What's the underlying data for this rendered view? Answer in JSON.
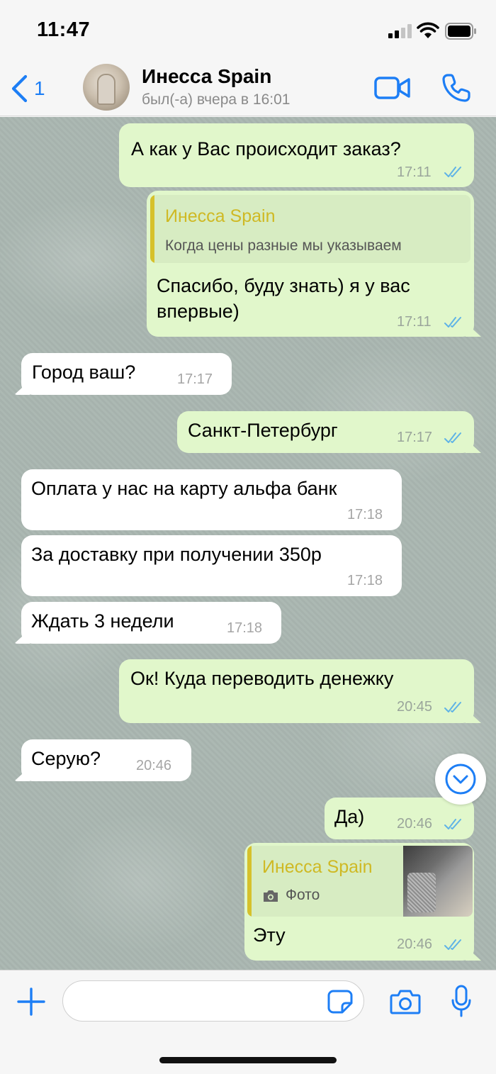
{
  "status_bar": {
    "time": "11:47"
  },
  "header": {
    "back_count": "1",
    "contact_name": "Инесса Spain",
    "contact_status": "был(-а) вчера в 16:01"
  },
  "messages": [
    {
      "direction": "outgoing",
      "text": "А как у Вас происходит заказ?",
      "time": "17:11",
      "read": true
    },
    {
      "direction": "outgoing",
      "quote_author": "Инесса Spain",
      "quote_text": "Когда цены разные мы указываем",
      "text_line1": "Спасибо, буду знать) я у вас",
      "text_line2": "впервые)",
      "time": "17:11",
      "read": true
    },
    {
      "direction": "incoming",
      "text": "Город ваш?",
      "time": "17:17"
    },
    {
      "direction": "outgoing",
      "text": "Санкт-Петербург",
      "time": "17:17",
      "read": true
    },
    {
      "direction": "incoming",
      "text": "Оплата у нас на карту альфа банк",
      "time": "17:18"
    },
    {
      "direction": "incoming",
      "text": "За доставку при получении 350р",
      "time": "17:18"
    },
    {
      "direction": "incoming",
      "text": "Ждать 3 недели",
      "time": "17:18"
    },
    {
      "direction": "outgoing",
      "text": "Ок! Куда переводить денежку",
      "time": "20:45",
      "read": true
    },
    {
      "direction": "incoming",
      "text": "Серую?",
      "time": "20:46"
    },
    {
      "direction": "outgoing",
      "text": "Да)",
      "time": "20:46",
      "read": true
    },
    {
      "direction": "outgoing",
      "quote_author": "Инесса Spain",
      "quote_text": "Фото",
      "text": "Эту",
      "time": "20:46",
      "read": true
    }
  ],
  "colors": {
    "accent": "#1d7ef5",
    "outgoing_bubble": "#e1f7cb",
    "incoming_bubble": "#ffffff",
    "read_ticks": "#5fb3e6",
    "quote_author": "#cfb924"
  },
  "icons": [
    "back-chevron-icon",
    "video-call-icon",
    "phone-icon",
    "double-check-icon",
    "camera-icon",
    "chevron-down-icon",
    "plus-icon",
    "sticker-icon",
    "microphone-icon"
  ]
}
